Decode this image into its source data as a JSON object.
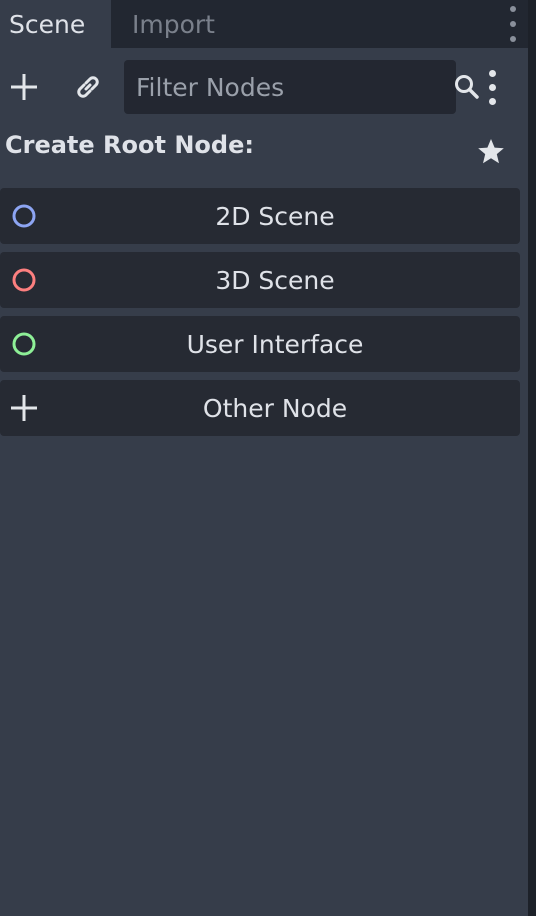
{
  "tabs": [
    {
      "label": "Scene",
      "active": true
    },
    {
      "label": "Import",
      "active": false
    }
  ],
  "toolbar": {
    "filter_placeholder": "Filter Nodes",
    "icons": [
      "plus-icon",
      "link-icon",
      "search-icon",
      "kebab-menu-icon"
    ]
  },
  "root_label": "Create Root Node:",
  "nodes": [
    {
      "label": "2D Scene",
      "icon": "circle-icon",
      "color": "#8da5f3"
    },
    {
      "label": "3D Scene",
      "icon": "circle-icon",
      "color": "#fc7f7f"
    },
    {
      "label": "User Interface",
      "icon": "circle-icon",
      "color": "#8eef97"
    },
    {
      "label": "Other Node",
      "icon": "plus-icon",
      "color": "#e0e0e0"
    }
  ]
}
